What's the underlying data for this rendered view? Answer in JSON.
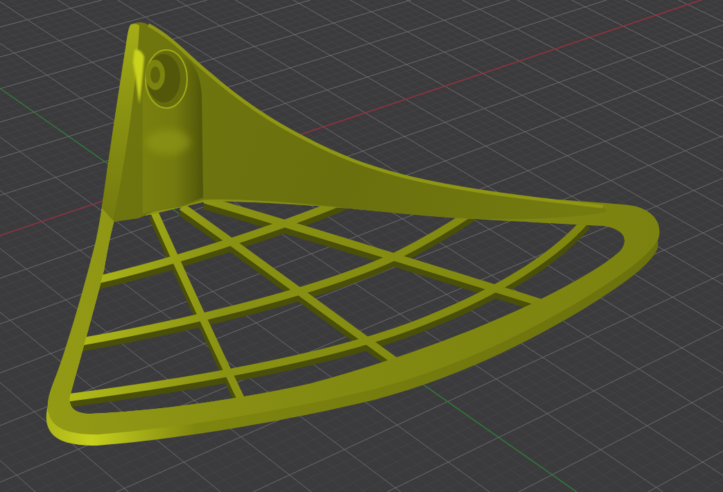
{
  "viewport": {
    "grid": true,
    "axes": [
      {
        "kind": "x",
        "color": "#9b2c3a"
      },
      {
        "kind": "y",
        "color": "#2d7d35"
      }
    ]
  }
}
